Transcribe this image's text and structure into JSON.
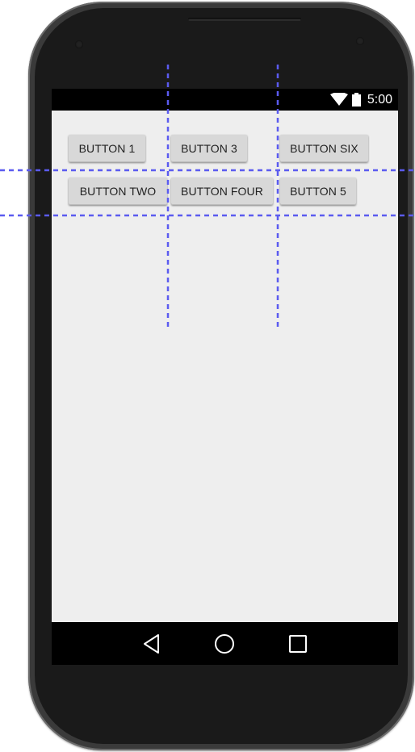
{
  "status_bar": {
    "time": "5:00",
    "wifi_icon": "wifi-icon",
    "battery_icon": "battery-icon"
  },
  "buttons": [
    {
      "label": "BUTTON 1"
    },
    {
      "label": "BUTTON 3"
    },
    {
      "label": "BUTTON SIX"
    },
    {
      "label": "BUTTON TWO"
    },
    {
      "label": "BUTTON FOUR"
    },
    {
      "label": "BUTTON 5"
    }
  ],
  "nav_bar": {
    "back_icon": "back-triangle-icon",
    "home_icon": "home-circle-icon",
    "recents_icon": "recents-square-icon"
  },
  "guides": {
    "color": "#5b5bf0",
    "style": "dashed"
  },
  "colors": {
    "screen_background": "#eeeeee",
    "button_background": "#d8d8d8",
    "bar_background": "#000000"
  }
}
